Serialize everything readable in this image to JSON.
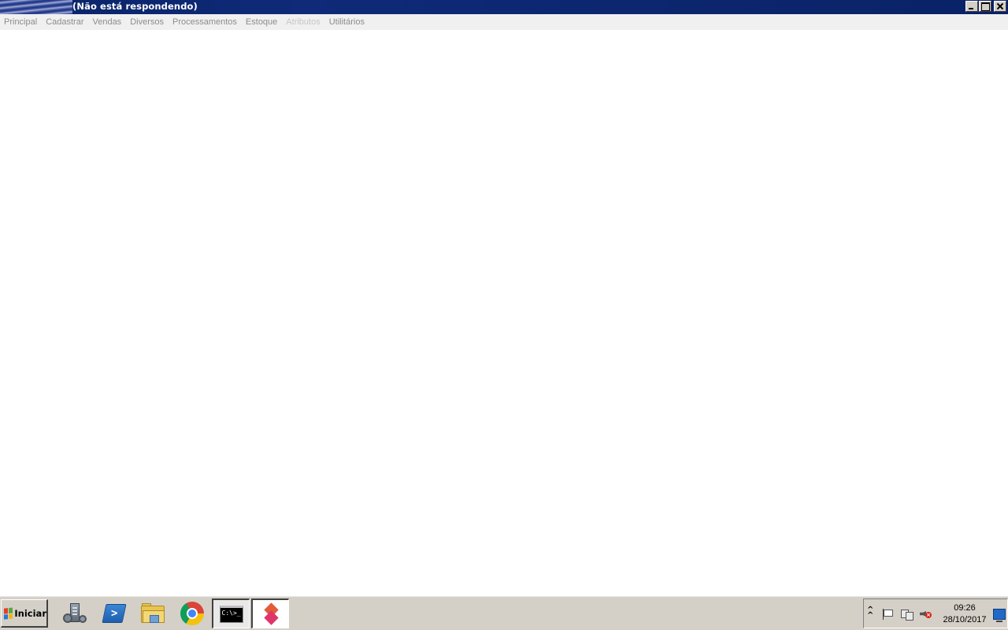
{
  "window": {
    "title": "(Não está respondendo)",
    "controls": {
      "minimize_icon": "minimize-icon",
      "maximize_icon": "maximize-icon",
      "close_icon": "close-icon"
    }
  },
  "menu": {
    "items": [
      {
        "label": "Principal",
        "enabled": true
      },
      {
        "label": "Cadastrar",
        "enabled": true
      },
      {
        "label": "Vendas",
        "enabled": true
      },
      {
        "label": "Diversos",
        "enabled": true
      },
      {
        "label": "Processamentos",
        "enabled": true
      },
      {
        "label": "Estoque",
        "enabled": true
      },
      {
        "label": "Atributos",
        "enabled": false
      },
      {
        "label": "Utilitários",
        "enabled": true
      }
    ]
  },
  "taskbar": {
    "start_label": "Iniciar",
    "apps": [
      {
        "icon": "server-manager-icon"
      },
      {
        "icon": "powershell-icon"
      },
      {
        "icon": "file-explorer-icon"
      },
      {
        "icon": "chrome-icon"
      },
      {
        "icon": "command-prompt-icon",
        "active": true
      },
      {
        "icon": "app-icon",
        "active": true
      }
    ],
    "cmd_text": "C:\\>_",
    "tray": {
      "icons": [
        "show-hidden-icons-icon",
        "action-center-flag-icon",
        "network-icon",
        "volume-muted-icon"
      ],
      "time": "09:26",
      "date": "28/10/2017"
    }
  },
  "colors": {
    "titlebar": "#0b2468",
    "menubar": "#f0f0f0",
    "menu_text": "#8c8c8c",
    "menu_disabled": "#c6c6c6",
    "taskbar": "#d4d0c8"
  }
}
